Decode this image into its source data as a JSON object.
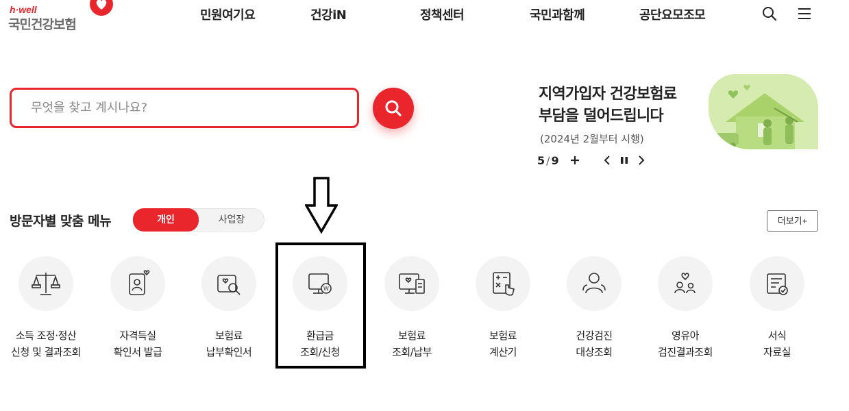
{
  "header": {
    "logo_tagline": "h·well",
    "logo_name": "국민건강보험",
    "nav": [
      "민원여기요",
      "건강iN",
      "정책센터",
      "국민과함께",
      "공단요모조모"
    ],
    "icons": [
      "search-icon",
      "menu-icon"
    ]
  },
  "search": {
    "placeholder": "무엇을 찾고 계시나요?",
    "value": ""
  },
  "banner": {
    "title_line1": "지역가입자 건강보험료",
    "title_line2": "부담을 덜어드립니다",
    "subtitle": "(2024년 2월부터 시행)",
    "current": "5",
    "separator": "/",
    "total": "9"
  },
  "section": {
    "title": "방문자별 맞춤 메뉴",
    "tabs": [
      "개인",
      "사업장"
    ],
    "active_tab": "개인",
    "more_label": "더보기+"
  },
  "menu": [
    {
      "line1": "소득 조정·정산",
      "line2": "신청 및 결과조회"
    },
    {
      "line1": "자격득실",
      "line2": "확인서 발급"
    },
    {
      "line1": "보험료",
      "line2": "납부확인서"
    },
    {
      "line1": "환급금",
      "line2": "조회/신청"
    },
    {
      "line1": "보험료",
      "line2": "조회/납부"
    },
    {
      "line1": "보험료",
      "line2": "계산기"
    },
    {
      "line1": "건강검진",
      "line2": "대상조회"
    },
    {
      "line1": "영유아",
      "line2": "검진결과조회"
    },
    {
      "line1": "서식",
      "line2": "자료실"
    }
  ],
  "colors": {
    "brand_red": "#e8262b",
    "banner_green": "#d6ebb0"
  }
}
